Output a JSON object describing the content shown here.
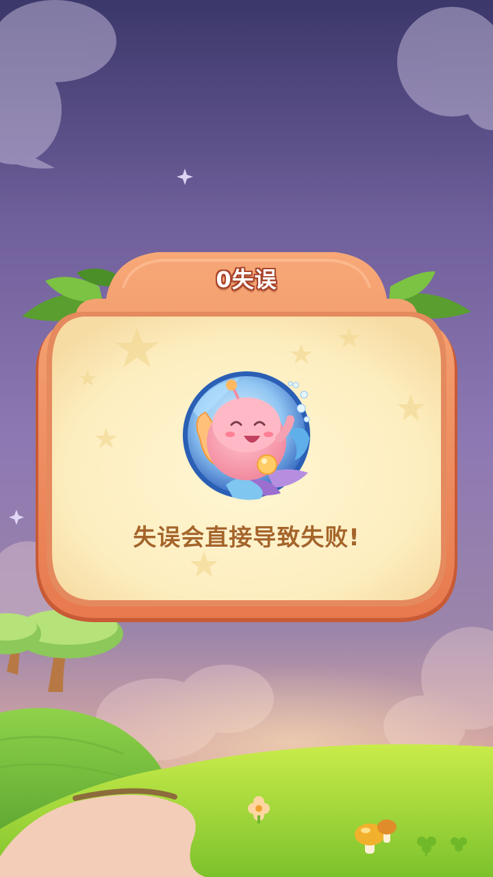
{
  "dialog": {
    "title": "0失误",
    "message": "失误会直接导致失败!"
  },
  "icons": {
    "character": "pink-fish-character-icon",
    "leaves": "leaf-icon",
    "flower": "flower-icon",
    "mushroom": "mushroom-icon",
    "clover": "clover-icon",
    "sparkle": "sparkle-icon",
    "star": "star-icon"
  },
  "colors": {
    "sky_top": "#3e3a6b",
    "sky_mid": "#8a75b4",
    "sky_low": "#d8a9a0",
    "panel_frame": "#f39a6b",
    "panel_frame_dark": "#d86a45",
    "panel_fill": "#fdf2cc",
    "title_stroke": "#a8432a",
    "message_text": "#a5652a",
    "grass": "#a9dc3a",
    "grass_dark": "#6fb829",
    "path": "#f3c9b3"
  }
}
